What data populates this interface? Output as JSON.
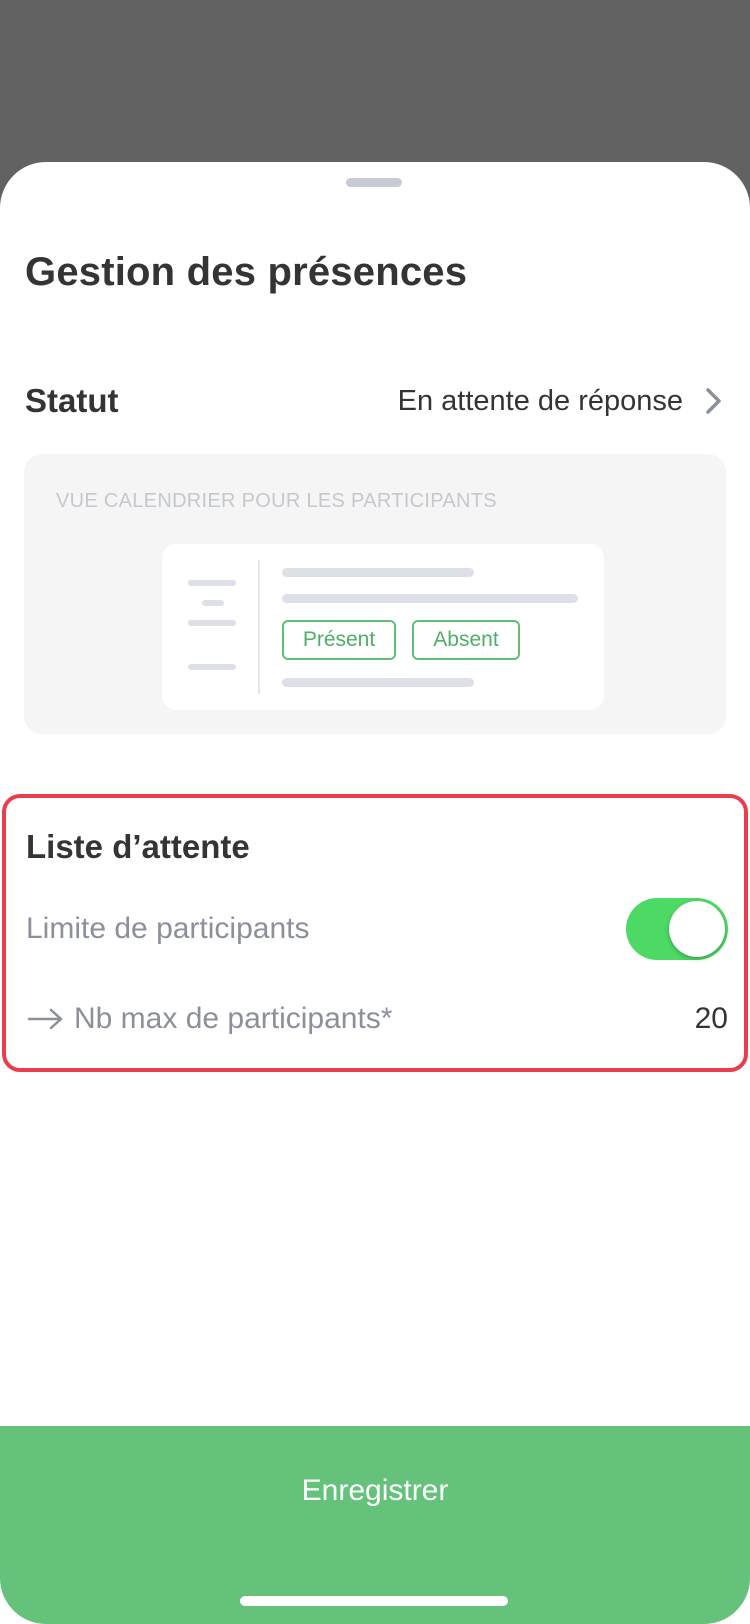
{
  "sheet": {
    "title": "Gestion des présences"
  },
  "status": {
    "label": "Statut",
    "value": "En attente de réponse",
    "icon": "chevron-right-icon"
  },
  "preview": {
    "caption": "VUE CALENDRIER POUR LES PARTICIPANTS",
    "present_label": "Présent",
    "absent_label": "Absent"
  },
  "waitlist": {
    "title": "Liste d’attente",
    "limit_label": "Limite de participants",
    "limit_enabled": true,
    "max_label": "Nb max de participants*",
    "max_value": "20",
    "arrow_icon": "arrow-right-icon"
  },
  "footer": {
    "save_label": "Enregistrer"
  },
  "colors": {
    "accent_green": "#64c27a",
    "toggle_green": "#4cd964",
    "highlight_red": "#ea3d4e"
  }
}
